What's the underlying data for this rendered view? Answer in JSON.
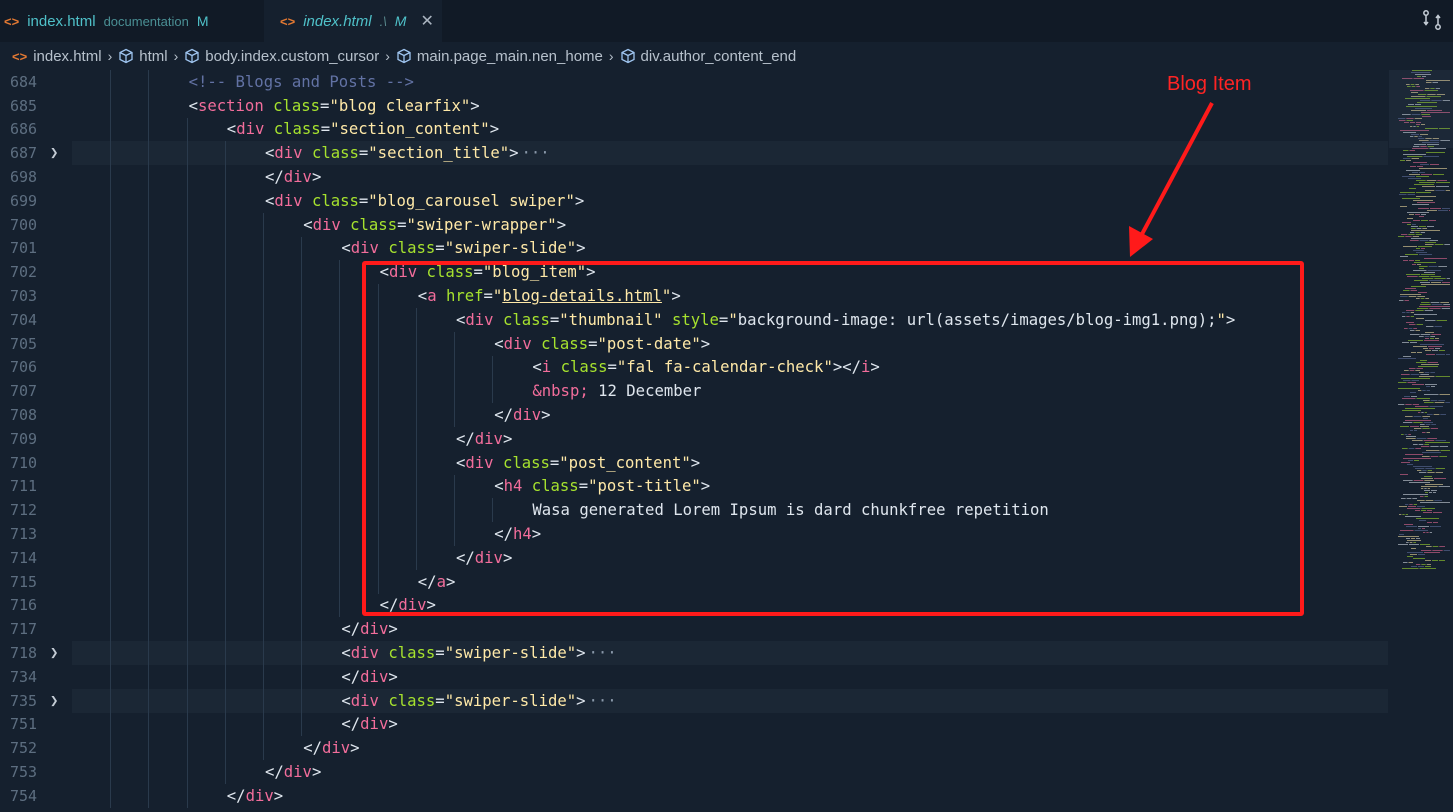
{
  "tabs": [
    {
      "name": "index.html",
      "description": "documentation",
      "status": "M",
      "active": false
    },
    {
      "name": "index.html",
      "description": ".\\",
      "status": "M",
      "active": true
    }
  ],
  "breadcrumb": [
    {
      "label": "index.html",
      "icon": "html-file-icon"
    },
    {
      "label": "html",
      "icon": "cube-icon"
    },
    {
      "label": "body.index.custom_cursor",
      "icon": "cube-icon"
    },
    {
      "label": "main.page_main.nen_home",
      "icon": "cube-icon"
    },
    {
      "label": "div.author_content_end",
      "icon": "cube-icon"
    }
  ],
  "annotation": {
    "label": "Blog Item",
    "color": "#ff1a1a"
  },
  "colors": {
    "tag": "#f26d9b",
    "attr": "#a6e22e",
    "value": "#ffe9a8",
    "comment": "#6272a4",
    "text": "#dfe6ee",
    "tab_text": "#4fc1c9"
  },
  "lines": [
    {
      "n": "684",
      "indent": 3,
      "tokens": [
        [
          "comment",
          "<!-- Blogs and Posts -->"
        ]
      ]
    },
    {
      "n": "685",
      "indent": 3,
      "tokens": [
        [
          "punct",
          "<"
        ],
        [
          "tag",
          "section"
        ],
        [
          "sp",
          " "
        ],
        [
          "attr",
          "class"
        ],
        [
          "eq",
          "="
        ],
        [
          "val",
          "\"blog clearfix\""
        ],
        [
          "punct",
          ">"
        ]
      ]
    },
    {
      "n": "686",
      "indent": 4,
      "tokens": [
        [
          "punct",
          "<"
        ],
        [
          "tag",
          "div"
        ],
        [
          "sp",
          " "
        ],
        [
          "attr",
          "class"
        ],
        [
          "eq",
          "="
        ],
        [
          "val",
          "\"section_content\""
        ],
        [
          "punct",
          ">"
        ]
      ]
    },
    {
      "n": "687",
      "indent": 5,
      "folded": true,
      "tokens": [
        [
          "punct",
          "<"
        ],
        [
          "tag",
          "div"
        ],
        [
          "sp",
          " "
        ],
        [
          "attr",
          "class"
        ],
        [
          "eq",
          "="
        ],
        [
          "val",
          "\"section_title\""
        ],
        [
          "punct",
          ">"
        ],
        [
          "ellipsis",
          "···"
        ]
      ]
    },
    {
      "n": "698",
      "indent": 5,
      "tokens": [
        [
          "punct",
          "</"
        ],
        [
          "tag",
          "div"
        ],
        [
          "punct",
          ">"
        ]
      ]
    },
    {
      "n": "699",
      "indent": 5,
      "tokens": [
        [
          "punct",
          "<"
        ],
        [
          "tag",
          "div"
        ],
        [
          "sp",
          " "
        ],
        [
          "attr",
          "class"
        ],
        [
          "eq",
          "="
        ],
        [
          "val",
          "\"blog_carousel swiper\""
        ],
        [
          "punct",
          ">"
        ]
      ]
    },
    {
      "n": "700",
      "indent": 6,
      "tokens": [
        [
          "punct",
          "<"
        ],
        [
          "tag",
          "div"
        ],
        [
          "sp",
          " "
        ],
        [
          "attr",
          "class"
        ],
        [
          "eq",
          "="
        ],
        [
          "val",
          "\"swiper-wrapper\""
        ],
        [
          "punct",
          ">"
        ]
      ]
    },
    {
      "n": "701",
      "indent": 7,
      "tokens": [
        [
          "punct",
          "<"
        ],
        [
          "tag",
          "div"
        ],
        [
          "sp",
          " "
        ],
        [
          "attr",
          "class"
        ],
        [
          "eq",
          "="
        ],
        [
          "val",
          "\"swiper-slide\""
        ],
        [
          "punct",
          ">"
        ]
      ]
    },
    {
      "n": "702",
      "indent": 8,
      "tokens": [
        [
          "punct",
          "<"
        ],
        [
          "tag",
          "div"
        ],
        [
          "sp",
          " "
        ],
        [
          "attr",
          "class"
        ],
        [
          "eq",
          "="
        ],
        [
          "val",
          "\"blog_item\""
        ],
        [
          "punct",
          ">"
        ]
      ]
    },
    {
      "n": "703",
      "indent": 9,
      "tokens": [
        [
          "punct",
          "<"
        ],
        [
          "tag",
          "a"
        ],
        [
          "sp",
          " "
        ],
        [
          "attr",
          "href"
        ],
        [
          "eq",
          "="
        ],
        [
          "val",
          "\""
        ],
        [
          "link",
          "blog-details.html"
        ],
        [
          "val",
          "\""
        ],
        [
          "punct",
          ">"
        ]
      ]
    },
    {
      "n": "704",
      "indent": 10,
      "tokens": [
        [
          "punct",
          "<"
        ],
        [
          "tag",
          "div"
        ],
        [
          "sp",
          " "
        ],
        [
          "attr",
          "class"
        ],
        [
          "eq",
          "="
        ],
        [
          "val",
          "\"thumbnail\""
        ],
        [
          "sp",
          " "
        ],
        [
          "attr",
          "style"
        ],
        [
          "eq",
          "="
        ],
        [
          "val",
          "\""
        ],
        [
          "text",
          "background-image: url"
        ],
        [
          "punct",
          "("
        ],
        [
          "text",
          "assets/images/blog-img1.png"
        ],
        [
          "punct",
          ")"
        ],
        [
          "text",
          ";"
        ],
        [
          "val",
          "\""
        ],
        [
          "punct",
          ">"
        ]
      ]
    },
    {
      "n": "705",
      "indent": 11,
      "tokens": [
        [
          "punct",
          "<"
        ],
        [
          "tag",
          "div"
        ],
        [
          "sp",
          " "
        ],
        [
          "attr",
          "class"
        ],
        [
          "eq",
          "="
        ],
        [
          "val",
          "\"post-date\""
        ],
        [
          "punct",
          ">"
        ]
      ]
    },
    {
      "n": "706",
      "indent": 12,
      "tokens": [
        [
          "punct",
          "<"
        ],
        [
          "tag",
          "i"
        ],
        [
          "sp",
          " "
        ],
        [
          "attr",
          "class"
        ],
        [
          "eq",
          "="
        ],
        [
          "val",
          "\"fal fa-calendar-check\""
        ],
        [
          "punct",
          "></"
        ],
        [
          "tag",
          "i"
        ],
        [
          "punct",
          ">"
        ]
      ]
    },
    {
      "n": "707",
      "indent": 12,
      "tokens": [
        [
          "ent",
          "&nbsp;"
        ],
        [
          "text",
          " 12 December"
        ]
      ]
    },
    {
      "n": "708",
      "indent": 11,
      "tokens": [
        [
          "punct",
          "</"
        ],
        [
          "tag",
          "div"
        ],
        [
          "punct",
          ">"
        ]
      ]
    },
    {
      "n": "709",
      "indent": 10,
      "tokens": [
        [
          "punct",
          "</"
        ],
        [
          "tag",
          "div"
        ],
        [
          "punct",
          ">"
        ]
      ]
    },
    {
      "n": "710",
      "indent": 10,
      "tokens": [
        [
          "punct",
          "<"
        ],
        [
          "tag",
          "div"
        ],
        [
          "sp",
          " "
        ],
        [
          "attr",
          "class"
        ],
        [
          "eq",
          "="
        ],
        [
          "val",
          "\"post_content\""
        ],
        [
          "punct",
          ">"
        ]
      ]
    },
    {
      "n": "711",
      "indent": 11,
      "tokens": [
        [
          "punct",
          "<"
        ],
        [
          "tag",
          "h4"
        ],
        [
          "sp",
          " "
        ],
        [
          "attr",
          "class"
        ],
        [
          "eq",
          "="
        ],
        [
          "val",
          "\"post-title\""
        ],
        [
          "punct",
          ">"
        ]
      ]
    },
    {
      "n": "712",
      "indent": 12,
      "tokens": [
        [
          "text",
          "Wasa generated Lorem Ipsum is dard chunkfree repetition"
        ]
      ]
    },
    {
      "n": "713",
      "indent": 11,
      "tokens": [
        [
          "punct",
          "</"
        ],
        [
          "tag",
          "h4"
        ],
        [
          "punct",
          ">"
        ]
      ]
    },
    {
      "n": "714",
      "indent": 10,
      "tokens": [
        [
          "punct",
          "</"
        ],
        [
          "tag",
          "div"
        ],
        [
          "punct",
          ">"
        ]
      ]
    },
    {
      "n": "715",
      "indent": 9,
      "tokens": [
        [
          "punct",
          "</"
        ],
        [
          "tag",
          "a"
        ],
        [
          "punct",
          ">"
        ]
      ]
    },
    {
      "n": "716",
      "indent": 8,
      "tokens": [
        [
          "punct",
          "</"
        ],
        [
          "tag",
          "div"
        ],
        [
          "punct",
          ">"
        ]
      ]
    },
    {
      "n": "717",
      "indent": 7,
      "tokens": [
        [
          "punct",
          "</"
        ],
        [
          "tag",
          "div"
        ],
        [
          "punct",
          ">"
        ]
      ]
    },
    {
      "n": "718",
      "indent": 7,
      "folded": true,
      "tokens": [
        [
          "punct",
          "<"
        ],
        [
          "tag",
          "div"
        ],
        [
          "sp",
          " "
        ],
        [
          "attr",
          "class"
        ],
        [
          "eq",
          "="
        ],
        [
          "val",
          "\"swiper-slide\""
        ],
        [
          "punct",
          ">"
        ],
        [
          "ellipsis",
          "···"
        ]
      ]
    },
    {
      "n": "734",
      "indent": 7,
      "tokens": [
        [
          "punct",
          "</"
        ],
        [
          "tag",
          "div"
        ],
        [
          "punct",
          ">"
        ]
      ]
    },
    {
      "n": "735",
      "indent": 7,
      "folded": true,
      "tokens": [
        [
          "punct",
          "<"
        ],
        [
          "tag",
          "div"
        ],
        [
          "sp",
          " "
        ],
        [
          "attr",
          "class"
        ],
        [
          "eq",
          "="
        ],
        [
          "val",
          "\"swiper-slide\""
        ],
        [
          "punct",
          ">"
        ],
        [
          "ellipsis",
          "···"
        ]
      ]
    },
    {
      "n": "751",
      "indent": 7,
      "tokens": [
        [
          "punct",
          "</"
        ],
        [
          "tag",
          "div"
        ],
        [
          "punct",
          ">"
        ]
      ]
    },
    {
      "n": "752",
      "indent": 6,
      "tokens": [
        [
          "punct",
          "</"
        ],
        [
          "tag",
          "div"
        ],
        [
          "punct",
          ">"
        ]
      ]
    },
    {
      "n": "753",
      "indent": 5,
      "tokens": [
        [
          "punct",
          "</"
        ],
        [
          "tag",
          "div"
        ],
        [
          "punct",
          ">"
        ]
      ]
    },
    {
      "n": "754",
      "indent": 4,
      "tokens": [
        [
          "punct",
          "</"
        ],
        [
          "tag",
          "div"
        ],
        [
          "punct",
          ">"
        ]
      ]
    }
  ]
}
